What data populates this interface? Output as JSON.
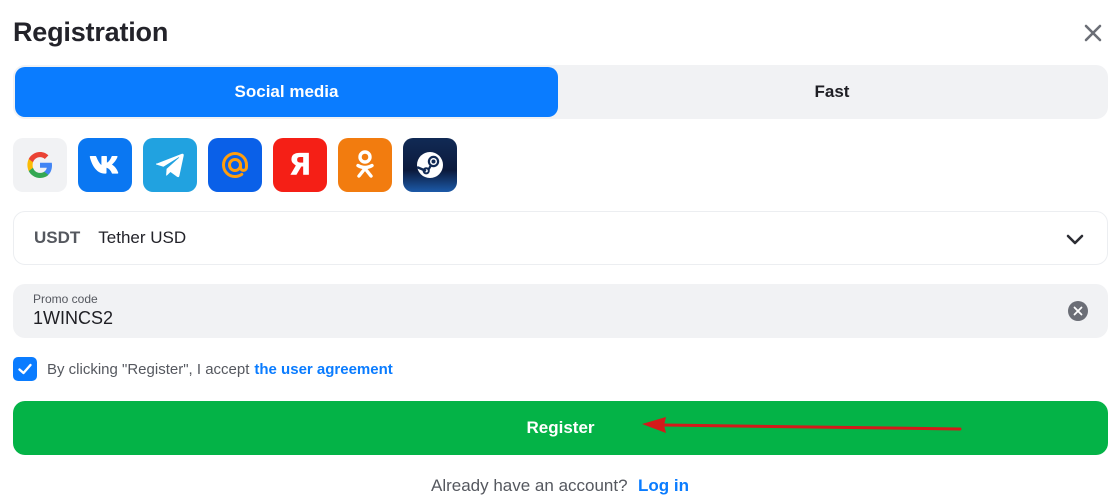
{
  "dialog": {
    "title": "Registration",
    "close_icon": "close-icon"
  },
  "tabs": [
    {
      "label": "Social media",
      "active": true
    },
    {
      "label": "Fast",
      "active": false
    }
  ],
  "social_providers": [
    {
      "id": "google",
      "icon": "google-icon",
      "color": "#f1f2f4"
    },
    {
      "id": "vk",
      "icon": "vk-icon",
      "color": "#0a77f2"
    },
    {
      "id": "telegram",
      "icon": "telegram-icon",
      "color": "#21a2e0"
    },
    {
      "id": "mail",
      "icon": "mail-at-icon",
      "color": "#0a60e8"
    },
    {
      "id": "yandex",
      "icon": "yandex-icon",
      "color": "#f51f16"
    },
    {
      "id": "odnoklassniki",
      "icon": "odnoklassniki-icon",
      "color": "#f27c0f"
    },
    {
      "id": "steam",
      "icon": "steam-icon",
      "color": "#112a55"
    }
  ],
  "currency": {
    "code": "USDT",
    "name": "Tether USD",
    "icon": "chevron-down-icon"
  },
  "promo": {
    "label": "Promo code",
    "value": "1WINCS2",
    "clear_icon": "clear-icon"
  },
  "agreement": {
    "checked": true,
    "text": "By clicking \"Register\", I accept",
    "link": "the user agreement"
  },
  "register_button": {
    "label": "Register",
    "color": "#04b347"
  },
  "login": {
    "text": "Already have an account?",
    "link": "Log in"
  },
  "colors": {
    "accent": "#0a7cff",
    "success": "#04b347",
    "annotation_arrow": "#d31a1a"
  }
}
